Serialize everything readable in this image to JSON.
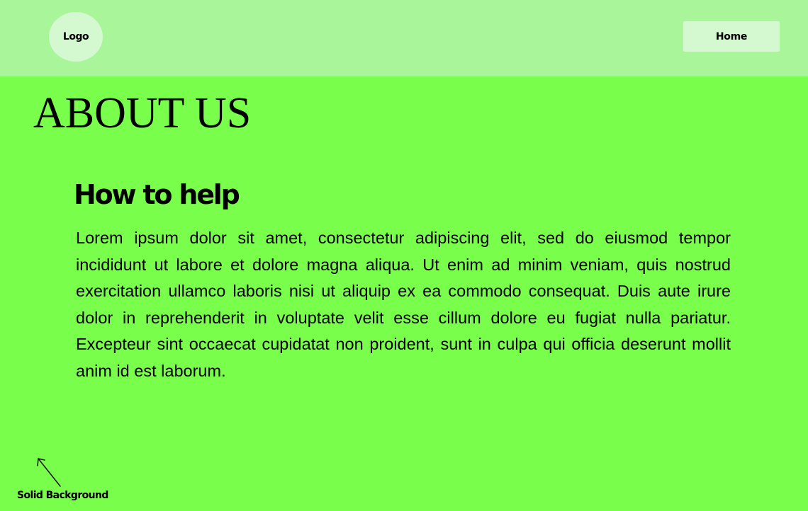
{
  "header": {
    "logo_label": "Logo",
    "nav": {
      "home_label": "Home"
    }
  },
  "main": {
    "title": "ABOUT US",
    "section": {
      "heading": "How to help",
      "body": "Lorem ipsum dolor sit amet, consectetur adipiscing elit, sed do eiusmod tempor incididunt ut labore et dolore magna aliqua. Ut enim ad minim veniam, quis nostrud exercitation ullamco laboris nisi ut aliquip ex ea commodo consequat. Duis aute irure dolor in reprehenderit in voluptate velit esse cillum dolore eu fugiat nulla pariatur. Excepteur sint occaecat cupidatat non proident, sunt in culpa qui officia deserunt mollit anim id est laborum."
    }
  },
  "annotation": {
    "label": "Solid Background",
    "icon": "arrow-up-left-icon"
  },
  "colors": {
    "background": "#79fe4c",
    "header": "#a8f59a",
    "logo_bg": "#d4f8cf",
    "button_bg": "#d4f8cf",
    "text": "#000000"
  }
}
